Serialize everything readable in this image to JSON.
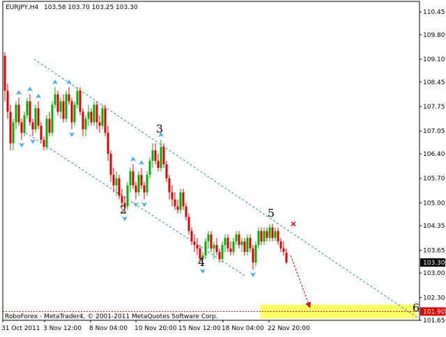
{
  "header": {
    "symbol": "EURJPY,H4",
    "ohlc": "103.58 103.70 103.25 103.30"
  },
  "footer": {
    "copyright": "RoboForex - MetaTrader4, © 2001-2011 MetaQuotes Software Corp."
  },
  "colors": {
    "bull": "#00b000",
    "bear": "#e00000",
    "fractal": "#3fa9f5",
    "channel": "#1e7fd0",
    "target_zone": "#ffff66",
    "price_box": "#000000",
    "target_label_box": "#e00000"
  },
  "chart_data": {
    "type": "candlestick",
    "symbol": "EURJPY",
    "timeframe": "H4",
    "ylim": [
      101.65,
      110.75
    ],
    "y_ticks": [
      "110.45",
      "109.80",
      "109.10",
      "108.45",
      "107.75",
      "107.05",
      "106.40",
      "105.70",
      "105.00",
      "104.35",
      "103.65",
      "103.00",
      "102.30",
      "101.65"
    ],
    "x_ticks": [
      "31 Oct 2011",
      "3 Nov 12:00",
      "8 Nov 04:00",
      "10 Nov 20:00",
      "15 Nov 12:00",
      "18 Nov 04:00",
      "22 Nov 20:00"
    ],
    "current_price": "103.30",
    "target_price": "101.90",
    "wave_labels": [
      {
        "label": "2",
        "bar": 43,
        "price": 104.7
      },
      {
        "label": "3",
        "bar": 56,
        "price": 107.0
      },
      {
        "label": "4",
        "bar": 71,
        "price": 103.2
      },
      {
        "label": "5",
        "bar": 96,
        "price": 104.6
      },
      {
        "label": "6",
        "bar": 148,
        "price": 101.9
      }
    ],
    "channel": {
      "upper": {
        "from": {
          "bar": 11,
          "price": 109.1
        },
        "to": {
          "bar": 149,
          "price": 101.7
        }
      },
      "lower": {
        "from": {
          "bar": 8,
          "price": 107.0
        },
        "to": {
          "bar": 87,
          "price": 102.9
        }
      }
    },
    "forecast_arrow": {
      "from": {
        "bar": 103,
        "price": 103.5
      },
      "to": {
        "bar": 110,
        "price": 102.0
      }
    },
    "x_marker": {
      "bar": 104,
      "price": 104.4
    },
    "target_zone": {
      "from_bar": 92,
      "to_bar": 148,
      "price_high": 102.1,
      "price_low": 101.7
    },
    "candles": [
      [
        109.2,
        109.3,
        107.9,
        108.2
      ],
      [
        108.2,
        108.4,
        107.4,
        107.6
      ],
      [
        107.6,
        107.8,
        106.5,
        106.7
      ],
      [
        106.7,
        107.4,
        106.5,
        107.3
      ],
      [
        107.3,
        107.9,
        107.1,
        107.8
      ],
      [
        107.8,
        108.0,
        107.2,
        107.3
      ],
      [
        107.3,
        107.4,
        106.8,
        107.0
      ],
      [
        107.0,
        107.6,
        106.9,
        107.5
      ],
      [
        107.5,
        108.0,
        107.4,
        107.9
      ],
      [
        107.9,
        108.1,
        107.2,
        107.3
      ],
      [
        107.3,
        107.4,
        106.9,
        107.1
      ],
      [
        107.1,
        107.8,
        107.0,
        107.7
      ],
      [
        107.7,
        107.9,
        107.1,
        107.2
      ],
      [
        107.2,
        107.3,
        106.7,
        106.8
      ],
      [
        106.8,
        106.9,
        106.5,
        106.6
      ],
      [
        106.6,
        107.5,
        106.5,
        107.4
      ],
      [
        107.4,
        107.6,
        106.9,
        107.0
      ],
      [
        107.0,
        107.9,
        106.9,
        107.8
      ],
      [
        107.8,
        108.3,
        107.7,
        108.1
      ],
      [
        108.1,
        108.2,
        107.5,
        107.6
      ],
      [
        107.6,
        108.0,
        107.4,
        107.9
      ],
      [
        107.9,
        108.1,
        107.3,
        107.4
      ],
      [
        107.4,
        108.2,
        107.3,
        108.1
      ],
      [
        108.1,
        108.3,
        107.8,
        107.9
      ],
      [
        107.9,
        108.0,
        107.1,
        107.3
      ],
      [
        107.3,
        107.9,
        107.2,
        107.8
      ],
      [
        107.8,
        108.3,
        107.7,
        108.2
      ],
      [
        108.2,
        108.3,
        107.5,
        107.6
      ],
      [
        107.6,
        107.7,
        106.9,
        107.1
      ],
      [
        107.1,
        107.5,
        106.9,
        107.4
      ],
      [
        107.4,
        107.8,
        107.2,
        107.6
      ],
      [
        107.6,
        107.7,
        107.2,
        107.3
      ],
      [
        107.3,
        107.9,
        107.2,
        107.8
      ],
      [
        107.8,
        107.9,
        107.1,
        107.3
      ],
      [
        107.3,
        107.5,
        107.0,
        107.2
      ],
      [
        107.2,
        107.8,
        107.1,
        107.7
      ],
      [
        107.7,
        107.8,
        106.9,
        107.0
      ],
      [
        107.0,
        107.2,
        106.2,
        106.4
      ],
      [
        106.4,
        106.5,
        105.6,
        105.8
      ],
      [
        105.8,
        106.0,
        105.3,
        105.5
      ],
      [
        105.5,
        105.9,
        105.2,
        105.7
      ],
      [
        105.7,
        105.8,
        105.1,
        105.2
      ],
      [
        105.2,
        105.4,
        104.8,
        105.0
      ],
      [
        105.0,
        105.2,
        104.7,
        104.9
      ],
      [
        104.9,
        105.6,
        104.8,
        105.5
      ],
      [
        105.5,
        106.0,
        105.3,
        105.9
      ],
      [
        105.9,
        106.1,
        105.4,
        105.5
      ],
      [
        105.5,
        105.6,
        105.1,
        105.3
      ],
      [
        105.3,
        105.9,
        105.2,
        105.8
      ],
      [
        105.8,
        106.0,
        105.4,
        105.5
      ],
      [
        105.5,
        105.6,
        105.1,
        105.3
      ],
      [
        105.3,
        105.9,
        105.2,
        105.8
      ],
      [
        105.8,
        106.3,
        105.7,
        106.2
      ],
      [
        106.2,
        106.7,
        106.0,
        106.5
      ],
      [
        106.5,
        106.7,
        106.1,
        106.2
      ],
      [
        106.2,
        106.4,
        105.9,
        106.0
      ],
      [
        106.0,
        106.8,
        105.9,
        106.6
      ],
      [
        106.6,
        106.7,
        106.0,
        106.1
      ],
      [
        106.1,
        106.2,
        105.6,
        105.7
      ],
      [
        105.7,
        105.8,
        105.1,
        105.3
      ],
      [
        105.3,
        105.5,
        104.9,
        105.1
      ],
      [
        105.1,
        105.3,
        104.8,
        104.9
      ],
      [
        104.9,
        105.1,
        104.7,
        104.8
      ],
      [
        104.8,
        105.4,
        104.7,
        105.3
      ],
      [
        105.3,
        105.4,
        104.8,
        104.9
      ],
      [
        104.9,
        105.0,
        104.5,
        104.6
      ],
      [
        104.6,
        104.7,
        104.1,
        104.2
      ],
      [
        104.2,
        104.3,
        103.8,
        103.9
      ],
      [
        103.9,
        104.1,
        103.6,
        103.8
      ],
      [
        103.8,
        104.0,
        103.5,
        103.7
      ],
      [
        103.7,
        103.8,
        103.3,
        103.4
      ],
      [
        103.4,
        103.6,
        103.2,
        103.5
      ],
      [
        103.5,
        104.0,
        103.4,
        103.9
      ],
      [
        103.9,
        104.2,
        103.7,
        104.1
      ],
      [
        104.1,
        104.2,
        103.6,
        103.7
      ],
      [
        103.7,
        103.9,
        103.4,
        103.8
      ],
      [
        103.8,
        104.0,
        103.5,
        103.6
      ],
      [
        103.6,
        103.7,
        103.3,
        103.4
      ],
      [
        103.4,
        103.9,
        103.3,
        103.8
      ],
      [
        103.8,
        104.1,
        103.6,
        104.0
      ],
      [
        104.0,
        104.1,
        103.6,
        103.7
      ],
      [
        103.7,
        103.9,
        103.5,
        103.6
      ],
      [
        103.6,
        104.0,
        103.5,
        103.9
      ],
      [
        103.9,
        104.2,
        103.8,
        104.1
      ],
      [
        104.1,
        104.2,
        103.7,
        103.8
      ],
      [
        103.8,
        104.0,
        103.6,
        103.9
      ],
      [
        103.9,
        104.0,
        103.5,
        103.6
      ],
      [
        103.6,
        104.1,
        103.5,
        104.0
      ],
      [
        104.0,
        104.1,
        103.6,
        103.7
      ],
      [
        103.7,
        103.8,
        103.1,
        103.3
      ],
      [
        103.3,
        103.9,
        103.2,
        103.8
      ],
      [
        103.8,
        104.3,
        103.7,
        104.2
      ],
      [
        104.2,
        104.3,
        103.8,
        103.9
      ],
      [
        103.9,
        104.3,
        103.8,
        104.2
      ],
      [
        104.2,
        104.3,
        103.9,
        104.0
      ],
      [
        104.0,
        104.4,
        103.9,
        104.3
      ],
      [
        104.3,
        104.4,
        103.9,
        104.0
      ],
      [
        104.0,
        104.3,
        103.9,
        104.2
      ],
      [
        104.2,
        104.3,
        103.8,
        103.9
      ],
      [
        103.9,
        104.0,
        103.6,
        103.7
      ],
      [
        103.7,
        103.9,
        103.5,
        103.6
      ],
      [
        103.58,
        103.7,
        103.25,
        103.3
      ]
    ]
  }
}
